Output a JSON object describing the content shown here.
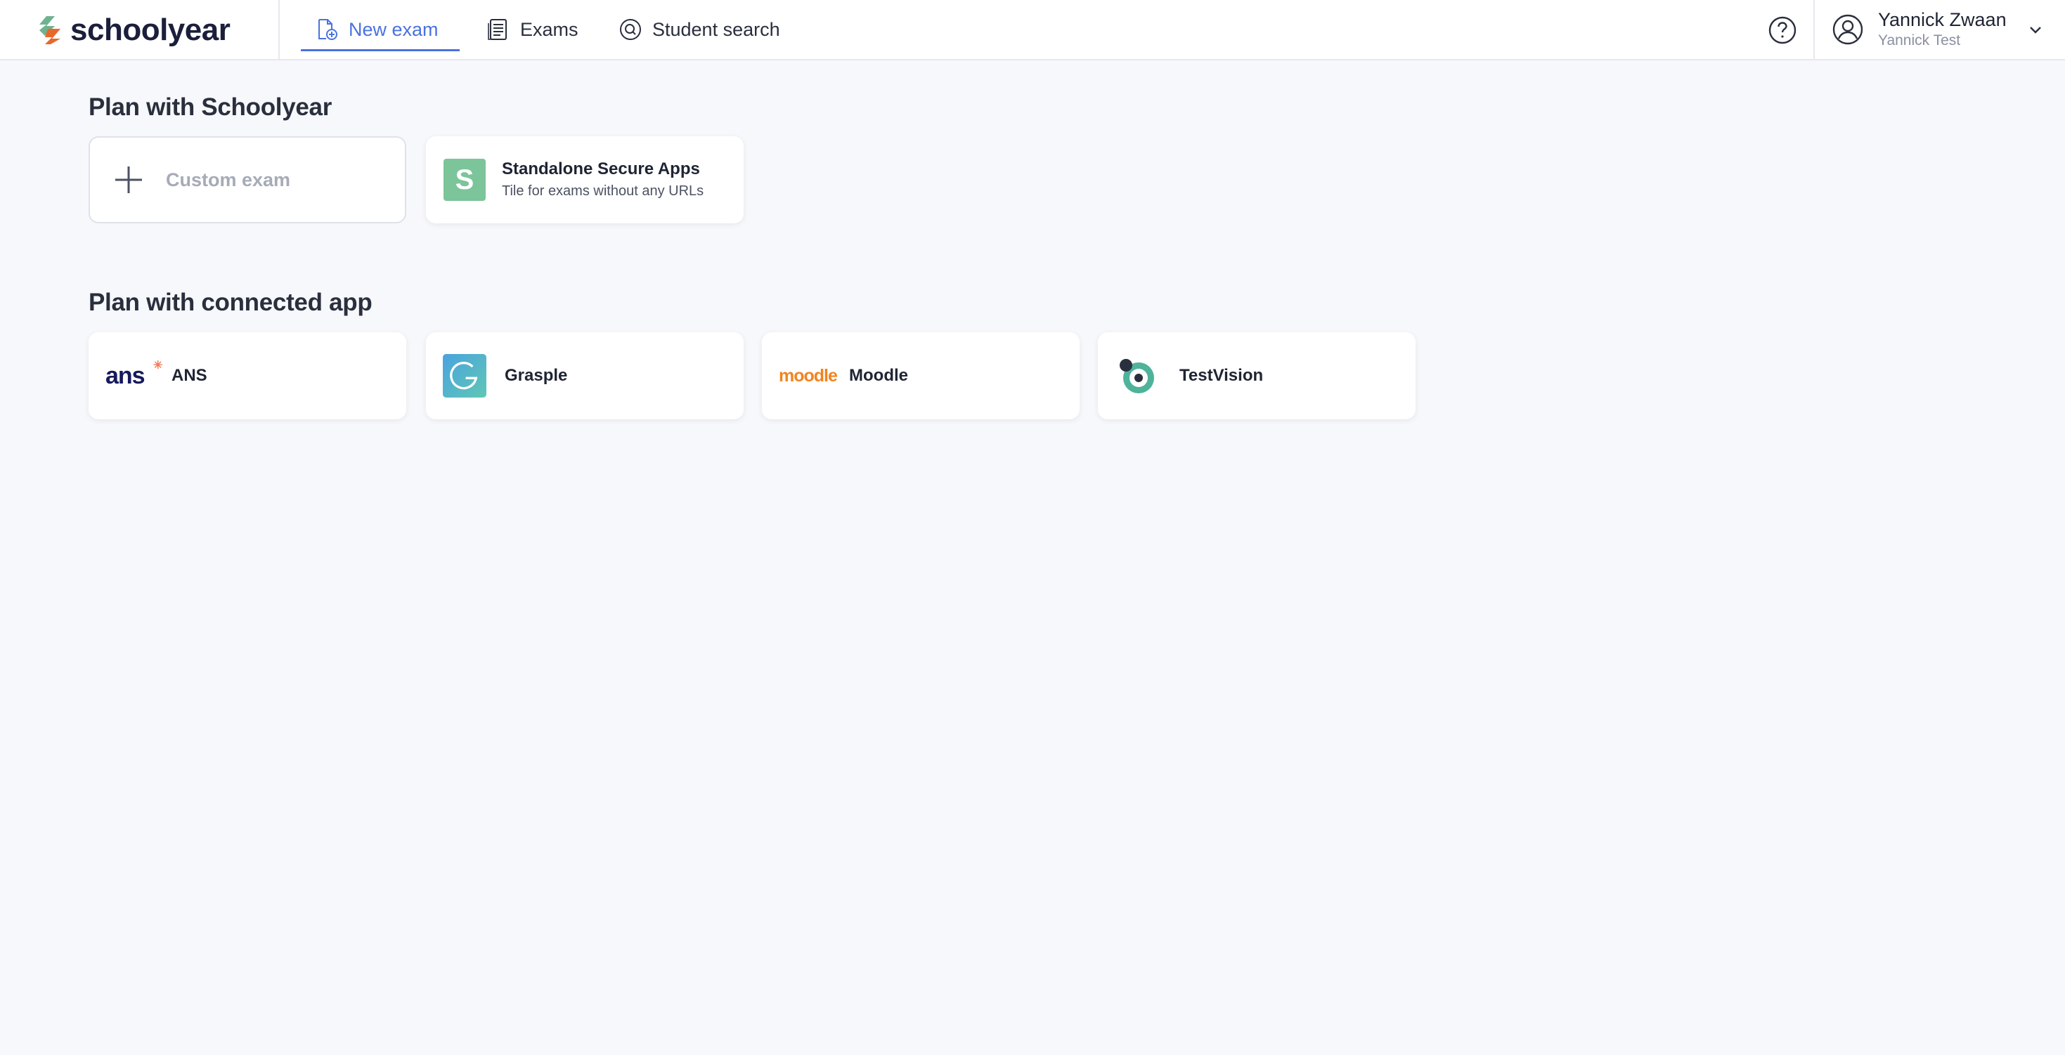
{
  "brand": {
    "name": "schoolyear",
    "colors": {
      "accent": "#4a72e0",
      "green": "#7cc49a",
      "orange": "#e8692b"
    }
  },
  "nav": {
    "items": [
      {
        "label": "New exam",
        "icon": "new-exam-icon",
        "active": true
      },
      {
        "label": "Exams",
        "icon": "exams-list-icon",
        "active": false
      },
      {
        "label": "Student search",
        "icon": "student-search-icon",
        "active": false
      }
    ]
  },
  "help": {
    "icon": "help-icon"
  },
  "user": {
    "name": "Yannick Zwaan",
    "org": "Yannick Test",
    "icon": "user-avatar-icon"
  },
  "sections": {
    "schoolyear": {
      "title": "Plan with Schoolyear",
      "tiles": [
        {
          "label": "Custom exam",
          "icon": "plus-icon"
        },
        {
          "title": "Standalone Secure Apps",
          "subtitle": "Tile for exams without any URLs",
          "badge": "S"
        }
      ]
    },
    "connected": {
      "title": "Plan with connected app",
      "tiles": [
        {
          "label": "ANS",
          "logo_text": "ans"
        },
        {
          "label": "Grasple",
          "logo_text": "G"
        },
        {
          "label": "Moodle",
          "logo_text": "moodle"
        },
        {
          "label": "TestVision",
          "logo_text": ""
        }
      ]
    }
  }
}
